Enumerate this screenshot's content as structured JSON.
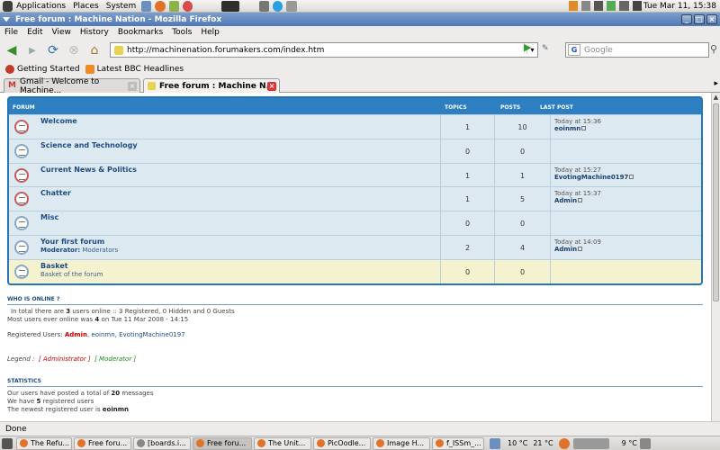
{
  "top_panel": {
    "menus": [
      "Applications",
      "Places",
      "System"
    ],
    "clock": "Tue Mar 11, 15:38"
  },
  "window": {
    "title": "Free forum : Machine Nation - Mozilla Firefox"
  },
  "menubar": [
    "File",
    "Edit",
    "View",
    "History",
    "Bookmarks",
    "Tools",
    "Help"
  ],
  "navbar": {
    "url": "http://machinenation.forumakers.com/index.htm",
    "search_placeholder": "Google",
    "search_engine": "G"
  },
  "bookmarks": [
    "Getting Started",
    "Latest BBC Headlines"
  ],
  "tabs": [
    {
      "label": "Gmail - Welcome to Machine...",
      "active": false
    },
    {
      "label": "Free forum : Machine N...",
      "active": true
    }
  ],
  "forum": {
    "headers": {
      "forum": "FORUM",
      "topics": "TOPICS",
      "posts": "POSTS",
      "last_post": "LAST POST"
    },
    "rows": [
      {
        "name": "Welcome",
        "desc": "",
        "topics": "1",
        "posts": "10",
        "last_time": "Today at 15:36",
        "last_user": "eoinmn",
        "hot": true
      },
      {
        "name": "Science and Technology",
        "desc": "",
        "topics": "0",
        "posts": "0",
        "last_time": "",
        "last_user": "",
        "hot": false
      },
      {
        "name": "Current News & Politics",
        "desc": "",
        "topics": "1",
        "posts": "1",
        "last_time": "Today at 15:27",
        "last_user": "EvotingMachine0197",
        "hot": true
      },
      {
        "name": "Chatter",
        "desc": "",
        "topics": "1",
        "posts": "5",
        "last_time": "Today at 15:37",
        "last_user": "Admin",
        "hot": true
      },
      {
        "name": "Misc",
        "desc": "",
        "topics": "0",
        "posts": "0",
        "last_time": "",
        "last_user": "",
        "hot": false
      },
      {
        "name": "Your first forum",
        "desc_label": "Moderator:",
        "desc": "Moderators",
        "topics": "2",
        "posts": "4",
        "last_time": "Today at 14:09",
        "last_user": "Admin",
        "hot": false
      },
      {
        "name": "Basket",
        "desc": "Basket of the forum",
        "topics": "0",
        "posts": "0",
        "last_time": "",
        "last_user": "",
        "hot": false
      }
    ]
  },
  "who_online": {
    "heading": "WHO IS ONLINE ?",
    "line1_pre": "In total there are",
    "line1_count": "3",
    "line1_post": "users online :: 3 Registered, 0 Hidden and 0 Guests",
    "line2_pre": "Most users ever online was",
    "line2_count": "4",
    "line2_post": "on Tue 11 Mar 2008 - 14:15",
    "registered_label": "Registered Users:",
    "registered_users": [
      "Admin",
      "eoinmn",
      "EvotingMachine0197"
    ],
    "legend_label": "Legend :",
    "legend_admin": "[ Administrator ]",
    "legend_mod": "[ Moderator ]"
  },
  "statistics": {
    "heading": "STATISTICS",
    "line1_pre": "Our users have posted a total of",
    "line1_count": "20",
    "line1_post": "messages",
    "line2_pre": "We have",
    "line2_count": "5",
    "line2_post": "registered users",
    "line3_pre": "The newest registered user is",
    "line3_user": "eoinmn"
  },
  "status_bar": "Done",
  "taskbar": {
    "tasks": [
      "The Refu...",
      "Free foru...",
      "[boards.i...",
      "Free foru...",
      "The Unit...",
      "PicOodle...",
      "Image H...",
      "f_ISSm_..."
    ],
    "weather1": "10 °C",
    "weather2": "21 °C",
    "weather3": "9 °C"
  },
  "colors": {
    "forum_border": "#2574b5",
    "row_bg": "#dde9f1",
    "row_highlight": "#f5f3cf",
    "admin": "#c00000",
    "moderator": "#1a8a1a"
  }
}
